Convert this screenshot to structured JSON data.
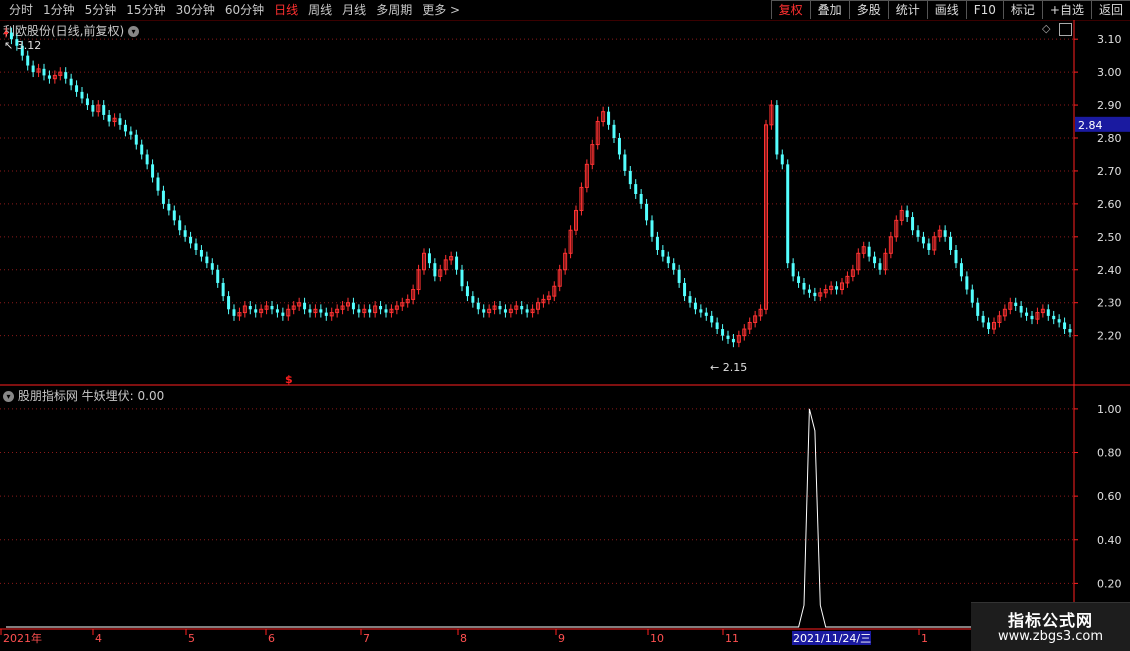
{
  "toolbar": {
    "periods": [
      "分时",
      "1分钟",
      "5分钟",
      "15分钟",
      "30分钟",
      "60分钟",
      "日线",
      "周线",
      "月线",
      "多周期",
      "更多 >"
    ],
    "active_period": "日线",
    "right_buttons": [
      "复权",
      "叠加",
      "多股",
      "统计",
      "画线",
      "F10",
      "标记",
      "+自选",
      "返回"
    ],
    "active_right": "复权"
  },
  "main_panel": {
    "title": "利欧股份(日线,前复权)",
    "high_label": "3.12",
    "low_label": "2.15",
    "signal_marker": "$",
    "price_badge": "2.84"
  },
  "indicator_panel": {
    "title": "股朋指标网",
    "indicator_name": "牛妖埋伏:",
    "indicator_value": "0.00"
  },
  "time_axis": {
    "labels": [
      "2021年",
      "4",
      "5",
      "6",
      "7",
      "8",
      "9",
      "10",
      "11",
      "2021/11/24/三",
      "1"
    ]
  },
  "watermark": {
    "line1": "指标公式网",
    "line2": "www.zbgs3.com"
  },
  "colors": {
    "up": "#ff3232",
    "down": "#54ffff",
    "grid": "#8c1a1a",
    "axis": "#ff2020",
    "badge_bg": "#1a1aa0"
  },
  "chart_data": [
    {
      "type": "candlestick",
      "title": "利欧股份(日线,前复权)",
      "ylim": [
        2.12,
        3.14
      ],
      "yticks": [
        2.2,
        2.3,
        2.4,
        2.5,
        2.6,
        2.7,
        2.8,
        2.9,
        3.0,
        3.1
      ],
      "close": [
        3.12,
        3.1,
        3.08,
        3.05,
        3.02,
        3.0,
        3.01,
        2.99,
        2.98,
        2.99,
        3.0,
        2.98,
        2.96,
        2.94,
        2.92,
        2.9,
        2.88,
        2.9,
        2.87,
        2.85,
        2.86,
        2.84,
        2.82,
        2.81,
        2.78,
        2.75,
        2.72,
        2.68,
        2.64,
        2.6,
        2.58,
        2.55,
        2.52,
        2.5,
        2.48,
        2.46,
        2.44,
        2.42,
        2.4,
        2.36,
        2.32,
        2.28,
        2.26,
        2.27,
        2.29,
        2.28,
        2.27,
        2.28,
        2.29,
        2.28,
        2.27,
        2.26,
        2.28,
        2.29,
        2.3,
        2.28,
        2.27,
        2.28,
        2.27,
        2.26,
        2.27,
        2.28,
        2.29,
        2.3,
        2.28,
        2.27,
        2.28,
        2.27,
        2.29,
        2.28,
        2.27,
        2.28,
        2.29,
        2.3,
        2.31,
        2.34,
        2.4,
        2.45,
        2.42,
        2.38,
        2.4,
        2.43,
        2.44,
        2.4,
        2.35,
        2.32,
        2.3,
        2.28,
        2.27,
        2.28,
        2.29,
        2.28,
        2.27,
        2.28,
        2.29,
        2.28,
        2.27,
        2.28,
        2.3,
        2.31,
        2.32,
        2.35,
        2.4,
        2.45,
        2.52,
        2.58,
        2.65,
        2.72,
        2.78,
        2.85,
        2.88,
        2.84,
        2.8,
        2.75,
        2.7,
        2.66,
        2.63,
        2.6,
        2.55,
        2.5,
        2.46,
        2.44,
        2.42,
        2.4,
        2.36,
        2.32,
        2.3,
        2.28,
        2.27,
        2.26,
        2.24,
        2.22,
        2.2,
        2.19,
        2.18,
        2.2,
        2.22,
        2.24,
        2.26,
        2.28,
        2.84,
        2.9,
        2.75,
        2.72,
        2.42,
        2.38,
        2.36,
        2.34,
        2.33,
        2.32,
        2.33,
        2.34,
        2.35,
        2.34,
        2.36,
        2.38,
        2.4,
        2.45,
        2.47,
        2.44,
        2.42,
        2.4,
        2.45,
        2.5,
        2.55,
        2.58,
        2.56,
        2.52,
        2.5,
        2.48,
        2.46,
        2.5,
        2.52,
        2.5,
        2.46,
        2.42,
        2.38,
        2.34,
        2.3,
        2.26,
        2.24,
        2.22,
        2.24,
        2.26,
        2.28,
        2.3,
        2.29,
        2.27,
        2.26,
        2.25,
        2.27,
        2.28,
        2.26,
        2.25,
        2.24,
        2.22,
        2.21
      ],
      "annotations": [
        {
          "text": "3.12",
          "kind": "high"
        },
        {
          "text": "2.15",
          "kind": "low"
        }
      ],
      "current_price": 2.84
    },
    {
      "type": "line",
      "title": "牛妖埋伏",
      "ylim": [
        0,
        1.05
      ],
      "yticks": [
        0.2,
        0.4,
        0.6,
        0.8,
        1.0
      ],
      "values_note": "0 everywhere except a spike",
      "spike": {
        "index": 147,
        "values": [
          0.1,
          1.0,
          0.9,
          0.1
        ]
      }
    }
  ]
}
